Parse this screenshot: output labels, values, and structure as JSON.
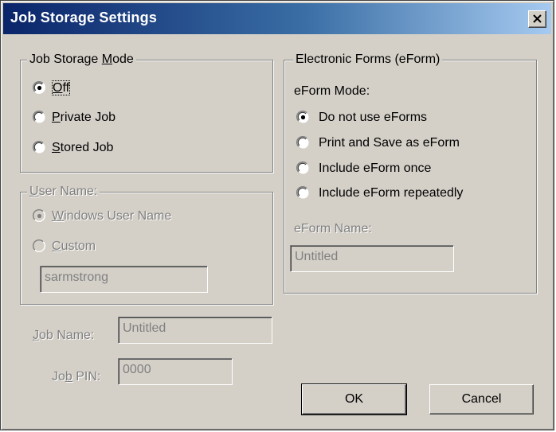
{
  "window": {
    "title": "Job Storage Settings",
    "close_icon": "close-x-icon"
  },
  "job_storage_mode": {
    "legend_prefix": "Job Storage ",
    "legend_accel": "M",
    "legend_suffix": "ode",
    "options": [
      {
        "accel": "O",
        "rest": "ff",
        "selected": true,
        "focused": true
      },
      {
        "accel": "P",
        "rest": "rivate Job",
        "selected": false
      },
      {
        "accel": "S",
        "rest": "tored Job",
        "selected": false
      }
    ]
  },
  "user_name": {
    "legend_accel": "U",
    "legend_rest": "ser Name:",
    "enabled": false,
    "options": [
      {
        "accel": "W",
        "rest": "indows User Name",
        "selected": true
      },
      {
        "accel": "C",
        "rest": "ustom",
        "selected": false
      }
    ],
    "custom_value": "sarmstrong"
  },
  "job_name": {
    "label_accel": "J",
    "label_rest": "ob Name:",
    "value": "Untitled"
  },
  "job_pin": {
    "label_prefix": "Jo",
    "label_accel": "b",
    "label_suffix": " PIN:",
    "value": "0000"
  },
  "eforms": {
    "legend": "Electronic Forms (eForm)",
    "mode_label": "eForm Mode:",
    "options": [
      {
        "label": "Do not use eForms",
        "selected": true
      },
      {
        "label": "Print and Save as eForm",
        "selected": false
      },
      {
        "label": "Include eForm once",
        "selected": false
      },
      {
        "label": "Include eForm repeatedly",
        "selected": false
      }
    ],
    "name_label": "eForm Name:",
    "name_value": "Untitled"
  },
  "buttons": {
    "ok": "OK",
    "cancel": "Cancel"
  },
  "colors": {
    "title_gradient_start": "#0a246a",
    "title_gradient_end": "#a6caf0",
    "face": "#d4d0c8",
    "disabled_text": "#808080"
  }
}
